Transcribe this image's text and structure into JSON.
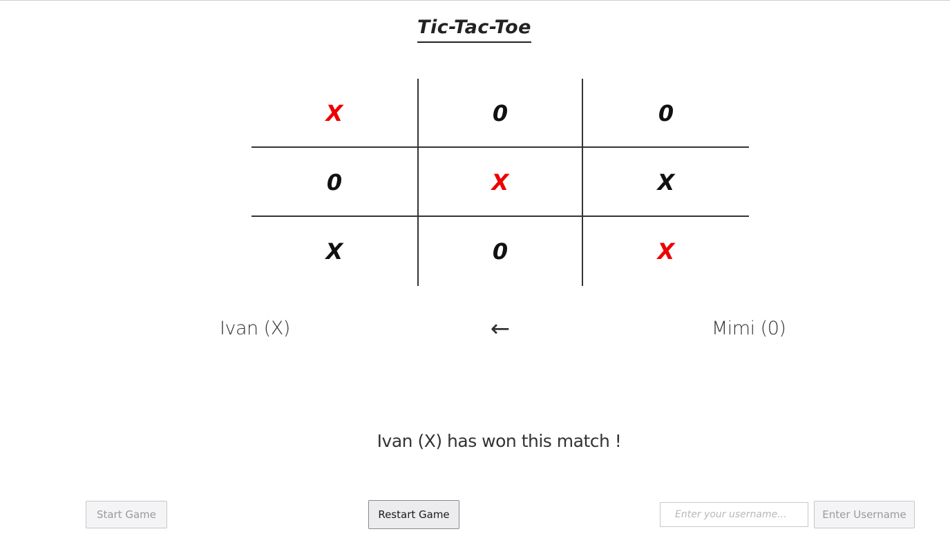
{
  "title": "Tic-Tac-Toe",
  "board": {
    "cells": [
      {
        "mark": "X",
        "winning": true
      },
      {
        "mark": "0",
        "winning": false
      },
      {
        "mark": "0",
        "winning": false
      },
      {
        "mark": "0",
        "winning": false
      },
      {
        "mark": "X",
        "winning": true
      },
      {
        "mark": "X",
        "winning": false
      },
      {
        "mark": "X",
        "winning": false
      },
      {
        "mark": "0",
        "winning": false
      },
      {
        "mark": "X",
        "winning": true
      }
    ]
  },
  "players": {
    "left": "Ivan (X)",
    "right": "Mimi (0)",
    "turn_arrow": "←"
  },
  "status": "Ivan (X) has won this match !",
  "controls": {
    "start_label": "Start Game",
    "restart_label": "Restart Game",
    "username_placeholder": "Enter your username...",
    "username_value": "",
    "enter_label": "Enter Username"
  },
  "colors": {
    "winning_mark": "#ee0000",
    "mark": "#111111"
  }
}
